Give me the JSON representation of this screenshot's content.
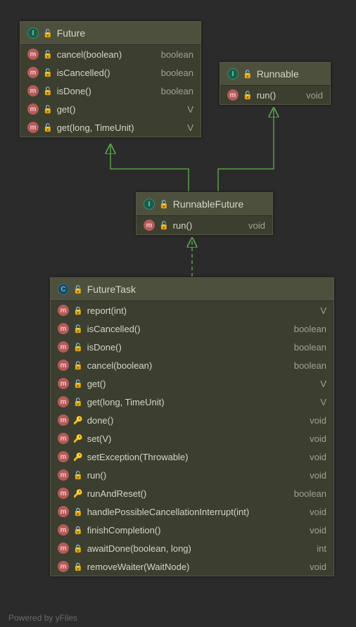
{
  "footer": "Powered by yFiles",
  "classes": {
    "future": {
      "name": "Future",
      "typeIcon": "I",
      "methods": [
        {
          "name": "cancel(boolean)",
          "ret": "boolean",
          "vis": "green"
        },
        {
          "name": "isCancelled()",
          "ret": "boolean",
          "vis": "green"
        },
        {
          "name": "isDone()",
          "ret": "boolean",
          "vis": "green"
        },
        {
          "name": "get()",
          "ret": "V",
          "vis": "green"
        },
        {
          "name": "get(long, TimeUnit)",
          "ret": "V",
          "vis": "green"
        }
      ]
    },
    "runnable": {
      "name": "Runnable",
      "typeIcon": "I",
      "methods": [
        {
          "name": "run()",
          "ret": "void",
          "vis": "green"
        }
      ]
    },
    "runnableFuture": {
      "name": "RunnableFuture",
      "typeIcon": "I",
      "methods": [
        {
          "name": "run()",
          "ret": "void",
          "vis": "green"
        }
      ]
    },
    "futureTask": {
      "name": "FutureTask",
      "typeIcon": "C",
      "methods": [
        {
          "name": "report(int)",
          "ret": "V",
          "vis": "lock"
        },
        {
          "name": "isCancelled()",
          "ret": "boolean",
          "vis": "green"
        },
        {
          "name": "isDone()",
          "ret": "boolean",
          "vis": "green"
        },
        {
          "name": "cancel(boolean)",
          "ret": "boolean",
          "vis": "green"
        },
        {
          "name": "get()",
          "ret": "V",
          "vis": "green"
        },
        {
          "name": "get(long, TimeUnit)",
          "ret": "V",
          "vis": "green"
        },
        {
          "name": "done()",
          "ret": "void",
          "vis": "gray"
        },
        {
          "name": "set(V)",
          "ret": "void",
          "vis": "gray"
        },
        {
          "name": "setException(Throwable)",
          "ret": "void",
          "vis": "gray"
        },
        {
          "name": "run()",
          "ret": "void",
          "vis": "green"
        },
        {
          "name": "runAndReset()",
          "ret": "boolean",
          "vis": "gray"
        },
        {
          "name": "handlePossibleCancellationInterrupt(int)",
          "ret": "void",
          "vis": "lock"
        },
        {
          "name": "finishCompletion()",
          "ret": "void",
          "vis": "lock"
        },
        {
          "name": "awaitDone(boolean, long)",
          "ret": "int",
          "vis": "lock"
        },
        {
          "name": "removeWaiter(WaitNode)",
          "ret": "void",
          "vis": "lock"
        }
      ]
    }
  }
}
